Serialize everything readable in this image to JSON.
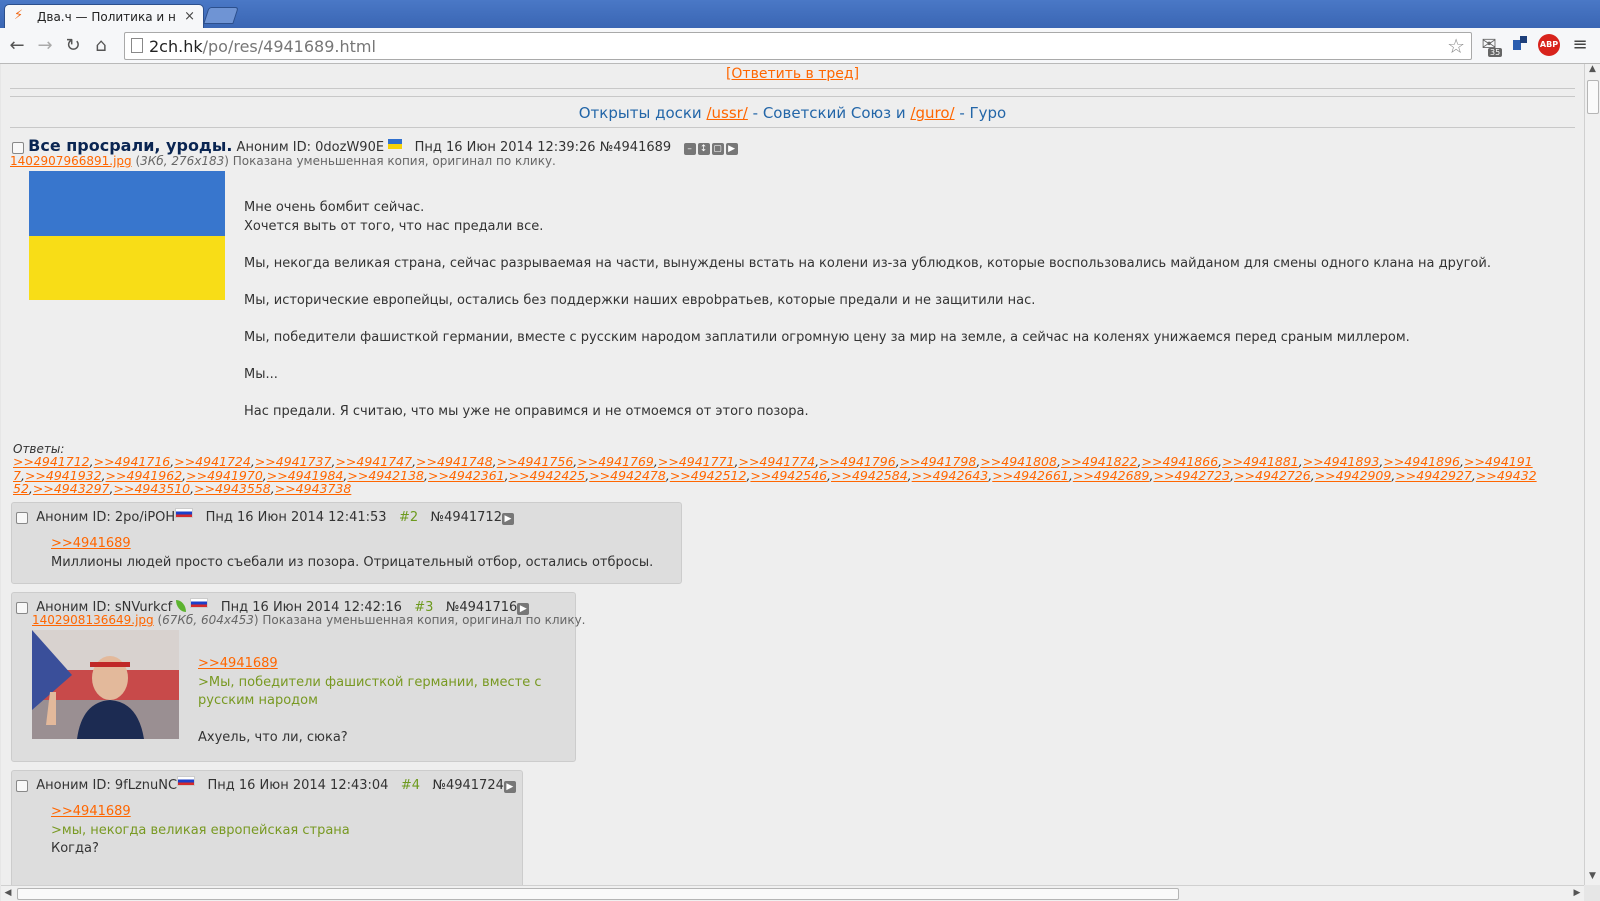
{
  "browser": {
    "tab_title": "Два.ч — Политика и н",
    "tab_close": "×",
    "url_host": "2ch.hk",
    "url_path": "/po/res/4941689.html",
    "mail_badge": "35",
    "abp_label": "ABP"
  },
  "page": {
    "reply_link": "[Ответить в тред]",
    "boards_prefix": "Открыты доски ",
    "board1": "/ussr/",
    "board1_desc": " - Советский Союз и ",
    "board2": "/guro/",
    "board2_desc": " - Гуро"
  },
  "op": {
    "subject": "Все просрали, уроды.",
    "author": "Аноним ID: 0dozW90E",
    "date": "Пнд 16 Июн 2014 12:39:26",
    "number": "№4941689",
    "file_name": "1402907966891.jpg",
    "file_meta": "3Кб, 276x183",
    "file_note": " Показана уменьшенная копия, оригинал по клику.",
    "text": [
      "Мне очень бомбит сейчас.",
      "Хочется выть от того, что нас предали все.",
      "",
      "Мы, некогда великая страна, сейчас разрываемая на части, вынуждены встать на колени из-за ублюдков, которые воспользовались майданом для смены одного клана на другой.",
      "",
      "Мы, исторические европейцы, остались без поддержки наших еврobратьев, которые предали и не защитили нас.",
      "",
      "Мы, победители фашисткой германии, вместе с русским народом заплатили огромную цену за мир на земле, а сейчас на коленях унижаемся перед сраным миллером.",
      "",
      "Мы...",
      "",
      "Нас предали. Я считаю, что мы уже не оправимся и не отмоемся от этого позора."
    ],
    "answers_label": "Ответы:",
    "answers": [
      ">>4941712",
      ">>4941716",
      ">>4941724",
      ">>4941737",
      ">>4941747",
      ">>4941748",
      ">>4941756",
      ">>4941769",
      ">>4941771",
      ">>4941774",
      ">>4941796",
      ">>4941798",
      ">>4941808",
      ">>4941822",
      ">>4941866",
      ">>4941881",
      ">>4941893",
      ">>4941896",
      ">>4941917",
      ">>4941932",
      ">>4941962",
      ">>4941970",
      ">>4941984",
      ">>4942138",
      ">>4942361",
      ">>4942425",
      ">>4942478",
      ">>4942512",
      ">>4942546",
      ">>4942584",
      ">>4942643",
      ">>4942661",
      ">>4942689",
      ">>4942723",
      ">>4942726",
      ">>4942909",
      ">>4942927",
      ">>4943252",
      ">>4943297",
      ">>4943510",
      ">>4943558",
      ">>4943738"
    ]
  },
  "replies": [
    {
      "author": "Аноним ID: 2po/iPOH",
      "date": "Пнд 16 Июн 2014 12:41:53",
      "index": "#2",
      "number": "№4941712",
      "ref": ">>4941689",
      "text": "Миллионы людей просто съебали из позора. Отрицательный отбор, остались отбросы."
    },
    {
      "author": "Аноним ID: sNVurkcf",
      "date": "Пнд 16 Июн 2014 12:42:16",
      "index": "#3",
      "number": "№4941716",
      "file_name": "1402908136649.jpg",
      "file_meta": "67Кб, 604x453",
      "file_note": " Показана уменьшенная копия, оригинал по клику.",
      "ref": ">>4941689",
      "quote": ">Мы, победители фашисткой германии, вместе с русским народом",
      "text": "Ахуель, что ли, сюка?"
    },
    {
      "author": "Аноним ID: 9fLznuNC",
      "date": "Пнд 16 Июн 2014 12:43:04",
      "index": "#4",
      "number": "№4941724",
      "ref": ">>4941689",
      "quote": ">мы, некогда великая европейская страна",
      "text": "Когда?"
    }
  ]
}
